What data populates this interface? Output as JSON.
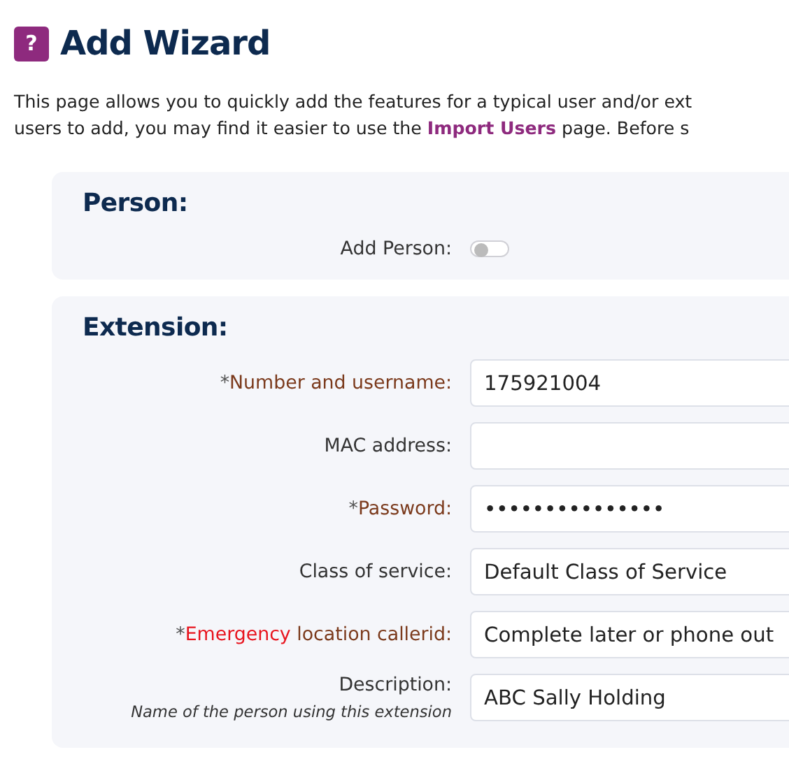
{
  "header": {
    "icon": "?",
    "title": "Add Wizard"
  },
  "intro": {
    "line_1": "This page allows you to quickly add the features for a typical user and/or ext",
    "line_2_before": "users to add, you may find it easier to use the ",
    "link": "Import Users",
    "line_2_after": " page. Before s"
  },
  "panels": [
    {
      "title": "Person:",
      "rows": [
        {
          "kind": "toggle",
          "label": [
            {
              "text": "Add Person:",
              "kind": "plain"
            }
          ],
          "on": false
        }
      ]
    },
    {
      "title": "Extension:",
      "rows": [
        {
          "kind": "field",
          "label": [
            {
              "text": "*",
              "kind": "mark"
            },
            {
              "text": "Number and username:",
              "kind": "required"
            }
          ],
          "value": "175921004"
        },
        {
          "kind": "field",
          "label": [
            {
              "text": "MAC address:",
              "kind": "plain"
            }
          ]
        },
        {
          "kind": "field",
          "label": [
            {
              "text": "*",
              "kind": "mark"
            },
            {
              "text": "Password:",
              "kind": "required"
            }
          ],
          "value": "•••••••••••••••"
        },
        {
          "kind": "field",
          "label": [
            {
              "text": "Class of service:",
              "kind": "plain"
            }
          ],
          "value": "Default Class of Service"
        },
        {
          "kind": "field",
          "label": [
            {
              "text": "*",
              "kind": "mark"
            },
            {
              "text": "Emergency",
              "kind": "alert"
            },
            {
              "text": " location callerid:",
              "kind": "required"
            }
          ],
          "value": "Complete later or phone out"
        },
        {
          "kind": "field",
          "label": [
            {
              "text": "Description:",
              "kind": "plain"
            }
          ],
          "hint": "Name of the person using this extension",
          "value": "ABC Sally Holding"
        }
      ]
    }
  ]
}
